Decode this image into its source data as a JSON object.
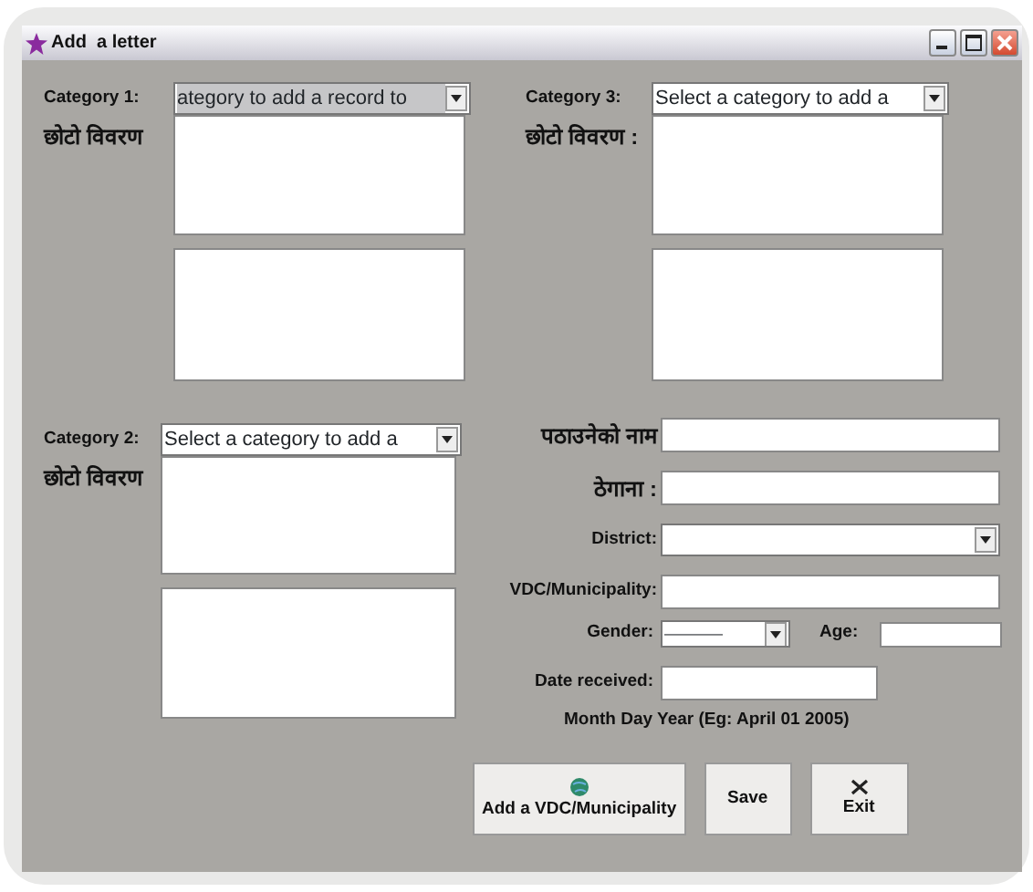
{
  "window": {
    "title": "Add  a letter"
  },
  "categories": [
    {
      "label": "Category 1:",
      "select_value": "ategory to add a record to",
      "highlighted": true,
      "description_label": "छोटो विवरण"
    },
    {
      "label": "Category 3:",
      "select_value": "Select a category to add a",
      "highlighted": false,
      "description_label": "छोटो विवरण :"
    },
    {
      "label": "Category 2:",
      "select_value": "Select a category to add a",
      "highlighted": false,
      "description_label": "छोटो विवरण"
    }
  ],
  "fields": [
    {
      "kind": "text",
      "label": "पठाउनेको नाम"
    },
    {
      "kind": "text",
      "label": "ठेगाना :"
    },
    {
      "kind": "select",
      "label": "District:"
    },
    {
      "kind": "text",
      "label": "VDC/Municipality:"
    }
  ],
  "gender": {
    "label": "Gender:",
    "value": "————"
  },
  "age": {
    "label": "Age:"
  },
  "date": {
    "label": "Date received:",
    "hint": "Month Day Year (Eg: April 01 2005)"
  },
  "buttons": [
    {
      "kind": "globe",
      "label": "Add a VDC/Municipality"
    },
    {
      "kind": "plain",
      "label": "Save"
    },
    {
      "kind": "cross",
      "label": "Exit"
    }
  ]
}
